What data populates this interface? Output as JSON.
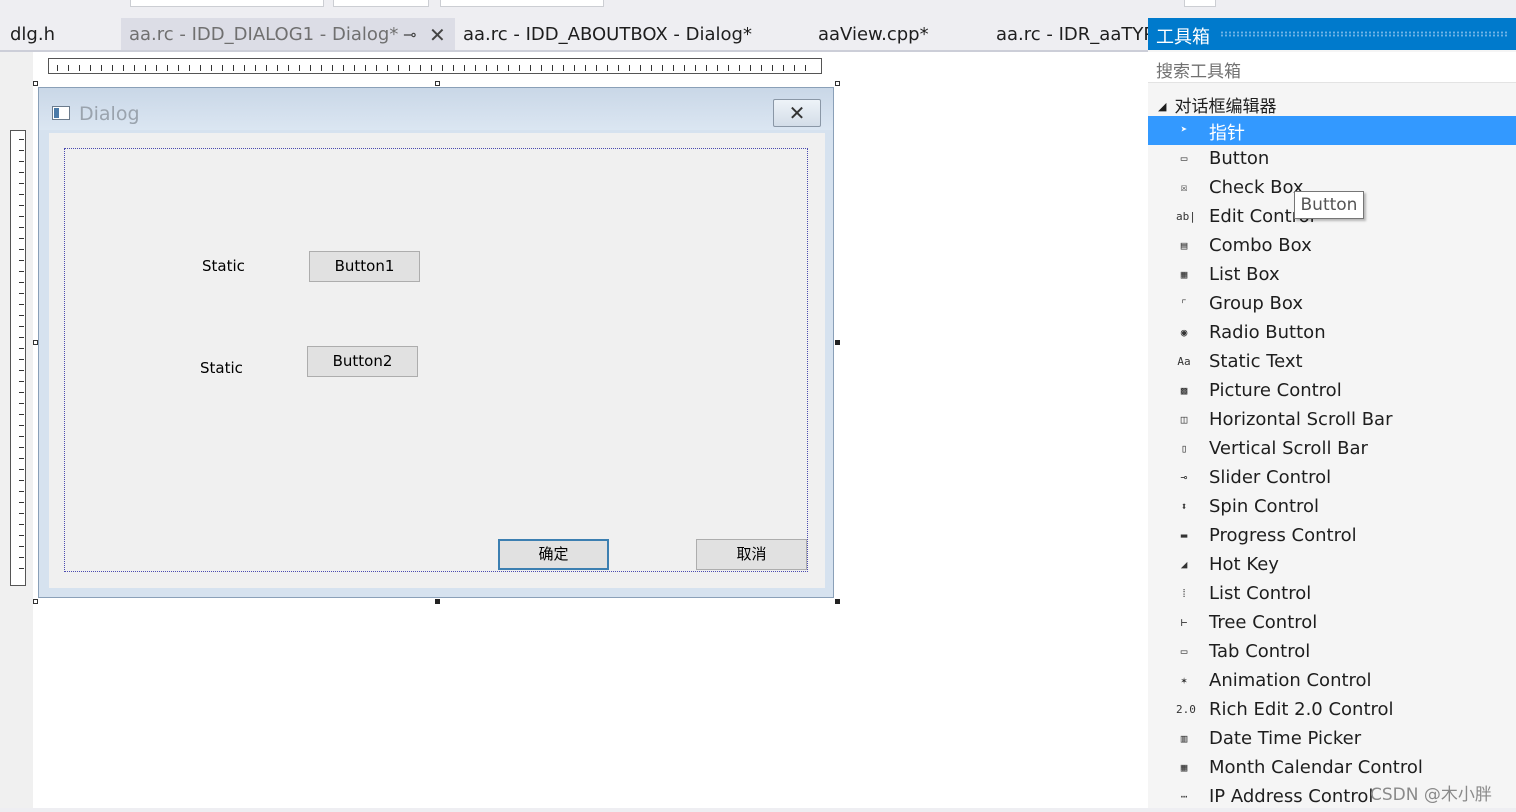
{
  "tabs": [
    {
      "label": "dlg.h",
      "active": false
    },
    {
      "label": "aa.rc - IDD_DIALOG1 - Dialog*",
      "active": true,
      "pin_icon": "pin-icon",
      "close_icon": "close-icon"
    },
    {
      "label": "aa.rc - IDD_ABOUTBOX - Dialog*",
      "active": false
    },
    {
      "label": "aaView.cpp*",
      "active": false
    },
    {
      "label": "aa.rc - IDR_aaTYP",
      "active": false
    }
  ],
  "dialog": {
    "title": "Dialog",
    "close_glyph": "✕",
    "statics": [
      "Static",
      "Static"
    ],
    "buttons": [
      "Button1",
      "Button2"
    ],
    "ok_label": "确定",
    "cancel_label": "取消"
  },
  "toolbox": {
    "title": "工具箱",
    "search_placeholder": "搜索工具箱",
    "category": "对话框编辑器",
    "items": [
      {
        "label": "指针",
        "icon": "pointer-icon",
        "glyph": "➤"
      },
      {
        "label": "Button",
        "icon": "button-icon",
        "glyph": "▭"
      },
      {
        "label": "Check Box",
        "icon": "checkbox-icon",
        "glyph": "☒"
      },
      {
        "label": "Edit Control",
        "icon": "edit-control-icon",
        "glyph": "ab|"
      },
      {
        "label": "Combo Box",
        "icon": "combo-box-icon",
        "glyph": "▤"
      },
      {
        "label": "List Box",
        "icon": "list-box-icon",
        "glyph": "▦"
      },
      {
        "label": "Group Box",
        "icon": "group-box-icon",
        "glyph": "⌜"
      },
      {
        "label": "Radio Button",
        "icon": "radio-button-icon",
        "glyph": "◉"
      },
      {
        "label": "Static Text",
        "icon": "static-text-icon",
        "glyph": "Aa"
      },
      {
        "label": "Picture Control",
        "icon": "picture-control-icon",
        "glyph": "▩"
      },
      {
        "label": "Horizontal Scroll Bar",
        "icon": "horizontal-scroll-bar-icon",
        "glyph": "◫"
      },
      {
        "label": "Vertical Scroll Bar",
        "icon": "vertical-scroll-bar-icon",
        "glyph": "▯"
      },
      {
        "label": "Slider Control",
        "icon": "slider-control-icon",
        "glyph": "⊸"
      },
      {
        "label": "Spin Control",
        "icon": "spin-control-icon",
        "glyph": "⬍"
      },
      {
        "label": "Progress Control",
        "icon": "progress-control-icon",
        "glyph": "▬"
      },
      {
        "label": "Hot Key",
        "icon": "hot-key-icon",
        "glyph": "◢"
      },
      {
        "label": "List Control",
        "icon": "list-control-icon",
        "glyph": "⁞"
      },
      {
        "label": "Tree Control",
        "icon": "tree-control-icon",
        "glyph": "⊢"
      },
      {
        "label": "Tab Control",
        "icon": "tab-control-icon",
        "glyph": "▭"
      },
      {
        "label": "Animation Control",
        "icon": "animation-control-icon",
        "glyph": "✶"
      },
      {
        "label": "Rich Edit 2.0 Control",
        "icon": "rich-edit-icon",
        "glyph": "2.0"
      },
      {
        "label": "Date Time Picker",
        "icon": "date-time-picker-icon",
        "glyph": "▥"
      },
      {
        "label": "Month Calendar Control",
        "icon": "month-calendar-icon",
        "glyph": "▦"
      },
      {
        "label": "IP Address Control",
        "icon": "ip-address-icon",
        "glyph": "⋯"
      }
    ]
  },
  "tooltip": "Button",
  "watermark": "CSDN @木小胖"
}
